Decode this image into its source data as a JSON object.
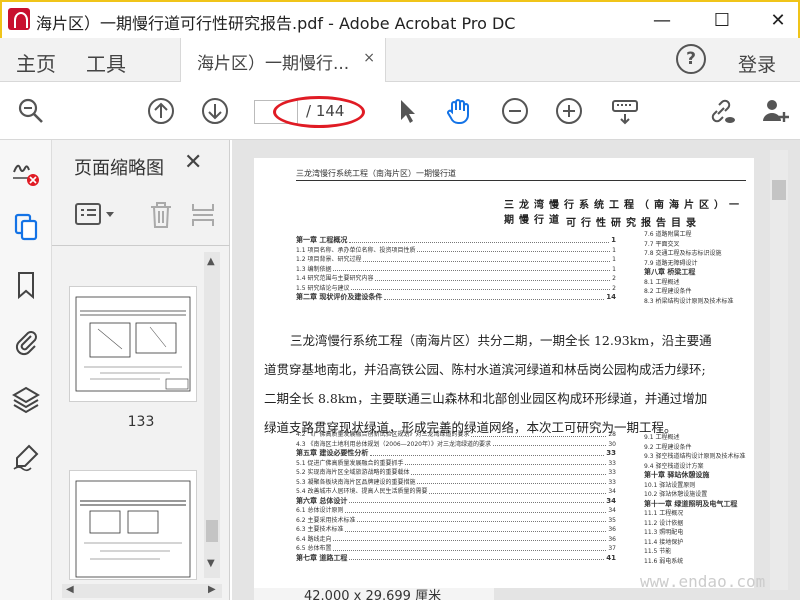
{
  "window": {
    "title": "海片区）一期慢行道可行性研究报告.pdf - Adobe Acrobat Pro DC",
    "minimize": "—",
    "maximize": "☐",
    "close": "✕"
  },
  "menubar": {
    "home": "主页",
    "tools": "工具",
    "doc_tab": "海片区）一期慢行...",
    "doc_tab_close": "×",
    "help": "?",
    "login": "登录"
  },
  "toolbar": {
    "page_current": "",
    "page_total": "/ 144"
  },
  "thumb_panel": {
    "title": "页面缩略图",
    "close": "✕",
    "thumbnails": [
      {
        "label": "133"
      },
      {
        "label": ""
      }
    ]
  },
  "document": {
    "header": "三龙湾慢行系统工程（南海片区）一期慢行道",
    "title_line1": "三龙湾慢行系统工程（南海片区）一期慢行道",
    "title_line2": "可行性研究报告目录",
    "toc_left_top": [
      {
        "text": "第一章    工程概况",
        "page": "1",
        "chap": true
      },
      {
        "text": "1.1    项目名称、承办单位名称、投资项目性质",
        "page": "1"
      },
      {
        "text": "1.2    项目背景、研究过程",
        "page": "1"
      },
      {
        "text": "1.3    编制依据",
        "page": "1"
      },
      {
        "text": "1.4    研究范围与主要研究内容",
        "page": "2"
      },
      {
        "text": "1.5    研究结论与建议",
        "page": "2"
      },
      {
        "text": "第二章    现状评价及建设条件",
        "page": "14",
        "chap": true
      }
    ],
    "toc_right_top": [
      {
        "text": "7.6    道路附属工程"
      },
      {
        "text": "7.7    平面交叉"
      },
      {
        "text": "7.8    交通工程及标志标识设施"
      },
      {
        "text": "7.9    道路无障碍设计"
      },
      {
        "text": "第八章    桥梁工程",
        "chap": true
      },
      {
        "text": "8.1    工程概述"
      },
      {
        "text": "8.2    工程建设条件"
      },
      {
        "text": "8.3    桥梁结构设计原则及技术标准"
      }
    ],
    "body_paragraph": [
      "三龙湾慢行系统工程（南海片区）共分二期，一期全长 12.93km，沿主要通",
      "道贯穿基地南北，并沿高铁公园、陈村水道滨河绿道和林岳岗公园构成活力绿环;",
      "二期全长 8.8km，主要联通三山森林和北部创业园区构成环形绿道，并通过增加",
      "绿道支路贯穿现状绿道，形成完善的绿道网络，本次工可研究为一期工程。"
    ],
    "toc_left_bottom": [
      {
        "text": "4.2    《广佛高质量发展融合创新试验区规划》对三龙湾绿道的要求",
        "page": "28"
      },
      {
        "text": "4.3    《南海区土地利用总体规划（2006—2020年）》对三龙湾绿道的要求",
        "page": "30"
      },
      {
        "text": "第五章    建设必要性分析",
        "page": "33",
        "chap": true
      },
      {
        "text": "5.1    促进广佛高质量发展融合的重要抓手",
        "page": "33"
      },
      {
        "text": "5.2    实现南海片区全域旅游战略的重要载体",
        "page": "33"
      },
      {
        "text": "5.3    凝聚各板块南海片区品牌建设的重要措施",
        "page": "33"
      },
      {
        "text": "5.4    改善城市人居环境、提高人民生活质量的需要",
        "page": "34"
      },
      {
        "text": "第六章    总体设计",
        "page": "34",
        "chap": true
      },
      {
        "text": "6.1    总体设计原则",
        "page": "34"
      },
      {
        "text": "6.2    主要采用技术标准",
        "page": "35"
      },
      {
        "text": "6.3    主要技术标准",
        "page": "36"
      },
      {
        "text": "6.4    路线走向",
        "page": "36"
      },
      {
        "text": "6.5    总体布置",
        "page": "37"
      },
      {
        "text": "第七章    道路工程",
        "page": "41",
        "chap": true
      }
    ],
    "toc_right_bottom": [
      {
        "text": "9.1    工程概述"
      },
      {
        "text": "9.2    工程建设条件"
      },
      {
        "text": "9.3    驿空栈道结构设计原则及技术标准"
      },
      {
        "text": "9.4    驿空栈道设计方案"
      },
      {
        "text": "第十章    驿站休憩设施",
        "chap": true
      },
      {
        "text": "10.1    驿站设置原则"
      },
      {
        "text": "10.2    驿站休憩设施设置"
      },
      {
        "text": "第十一章    绿道照明及电气工程",
        "chap": true
      },
      {
        "text": "11.1    工程概况"
      },
      {
        "text": "11.2    设计依据"
      },
      {
        "text": "11.3    照明配电"
      },
      {
        "text": "11.4    接地保护"
      },
      {
        "text": "11.5    节能"
      },
      {
        "text": "11.6    弱电系统"
      }
    ],
    "status": "42.000 x 29.699 厘米",
    "watermark": "www.endao.com"
  }
}
